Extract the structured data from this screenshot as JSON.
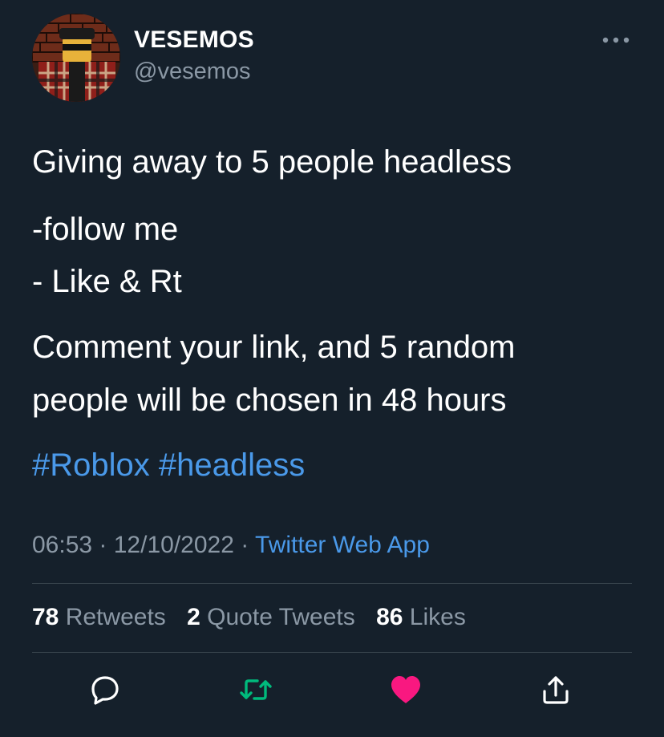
{
  "author": {
    "display_name": "VESEMOS",
    "handle": "@vesemos",
    "avatar_icon": "avatar-image"
  },
  "tweet": {
    "lines": [
      "Giving away to 5 people headless",
      "-follow me",
      "- Like & Rt",
      "Comment your link, and 5 random",
      "people will be chosen in 48 hours"
    ],
    "hashtags": [
      "#Roblox",
      "#headless"
    ]
  },
  "meta": {
    "time": "06:53",
    "separator": " · ",
    "date": "12/10/2022",
    "source": "Twitter Web App"
  },
  "stats": {
    "retweets_count": "78",
    "retweets_label": "Retweets",
    "quotes_count": "2",
    "quotes_label": "Quote Tweets",
    "likes_count": "86",
    "likes_label": "Likes"
  },
  "actions": {
    "reply_icon": "reply-icon",
    "retweet_icon": "retweet-icon",
    "like_icon": "heart-icon",
    "share_icon": "share-icon"
  },
  "colors": {
    "background": "#15202b",
    "link": "#4a99e9",
    "muted": "#8b98a5",
    "divider": "#38444d",
    "retweet": "#00ba7c",
    "like": "#f91880"
  }
}
